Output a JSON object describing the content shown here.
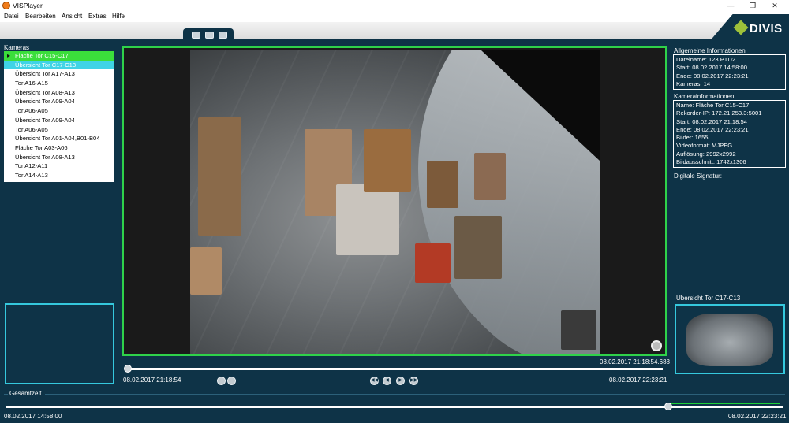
{
  "window": {
    "title": "VISPlayer",
    "minimize": "—",
    "maximize": "❐",
    "close": "✕"
  },
  "menu": [
    "Datei",
    "Bearbeiten",
    "Ansicht",
    "Extras",
    "Hilfe"
  ],
  "brand": {
    "logo_text": "DIVIS",
    "accent": "#9ec13a"
  },
  "cameras": {
    "label": "Kameras",
    "items": [
      "Fläche Tor C15-C17",
      "Übersicht Tor C17-C13",
      "Übersicht Tor A17-A13",
      "Tor A16-A15",
      "Übersicht Tor A08-A13",
      "Übersicht Tor A09-A04",
      "Tor A06-A05",
      "Übersicht Tor A09-A04",
      "Tor A06-A05",
      "Übersicht Tor A01-A04,B01-B04",
      "Fläche Tor A03-A06",
      "Übersicht Tor A08-A13",
      "Tor A12-A11",
      "Tor A14-A13"
    ],
    "active_index": 0,
    "selected_index": 1
  },
  "video": {
    "current_time": "08.02.2017 21:18:54.688",
    "start_time": "08.02.2017 21:18:54",
    "end_time": "08.02.2017 22:23:21",
    "progress": 0.0
  },
  "total": {
    "label": "Gesamtzeit",
    "start": "08.02.2017 14:58:00",
    "end": "08.02.2017 22:23:21",
    "progress": 0.91
  },
  "general_info": {
    "title": "Allgemeine Informationen",
    "lines": [
      "Dateiname:  123.PTD2",
      "Start:  08.02.2017 14:58:00",
      "Ende:  08.02.2017 22:23:21",
      "Kameras:  14"
    ]
  },
  "camera_info": {
    "title": "Kamerainformationen",
    "lines": [
      "Name:  Fläche Tor C15-C17",
      "Rekorder-IP:  172.21.253.3:5001",
      "Start:  08.02.2017 21:18:54",
      "Ende:  08.02.2017 22:23:21",
      "Bilder: 1655",
      "Videoformat: MJPEG",
      "Auflösung:  2992x2992",
      "Bildausschnitt:  1742x1306"
    ]
  },
  "signature_label": "Digitale Signatur:",
  "preview_label": "Übersicht Tor C17-C13",
  "colors": {
    "background": "#0e3347",
    "video_border": "#2fd24a",
    "cyan": "#35c8dd"
  }
}
